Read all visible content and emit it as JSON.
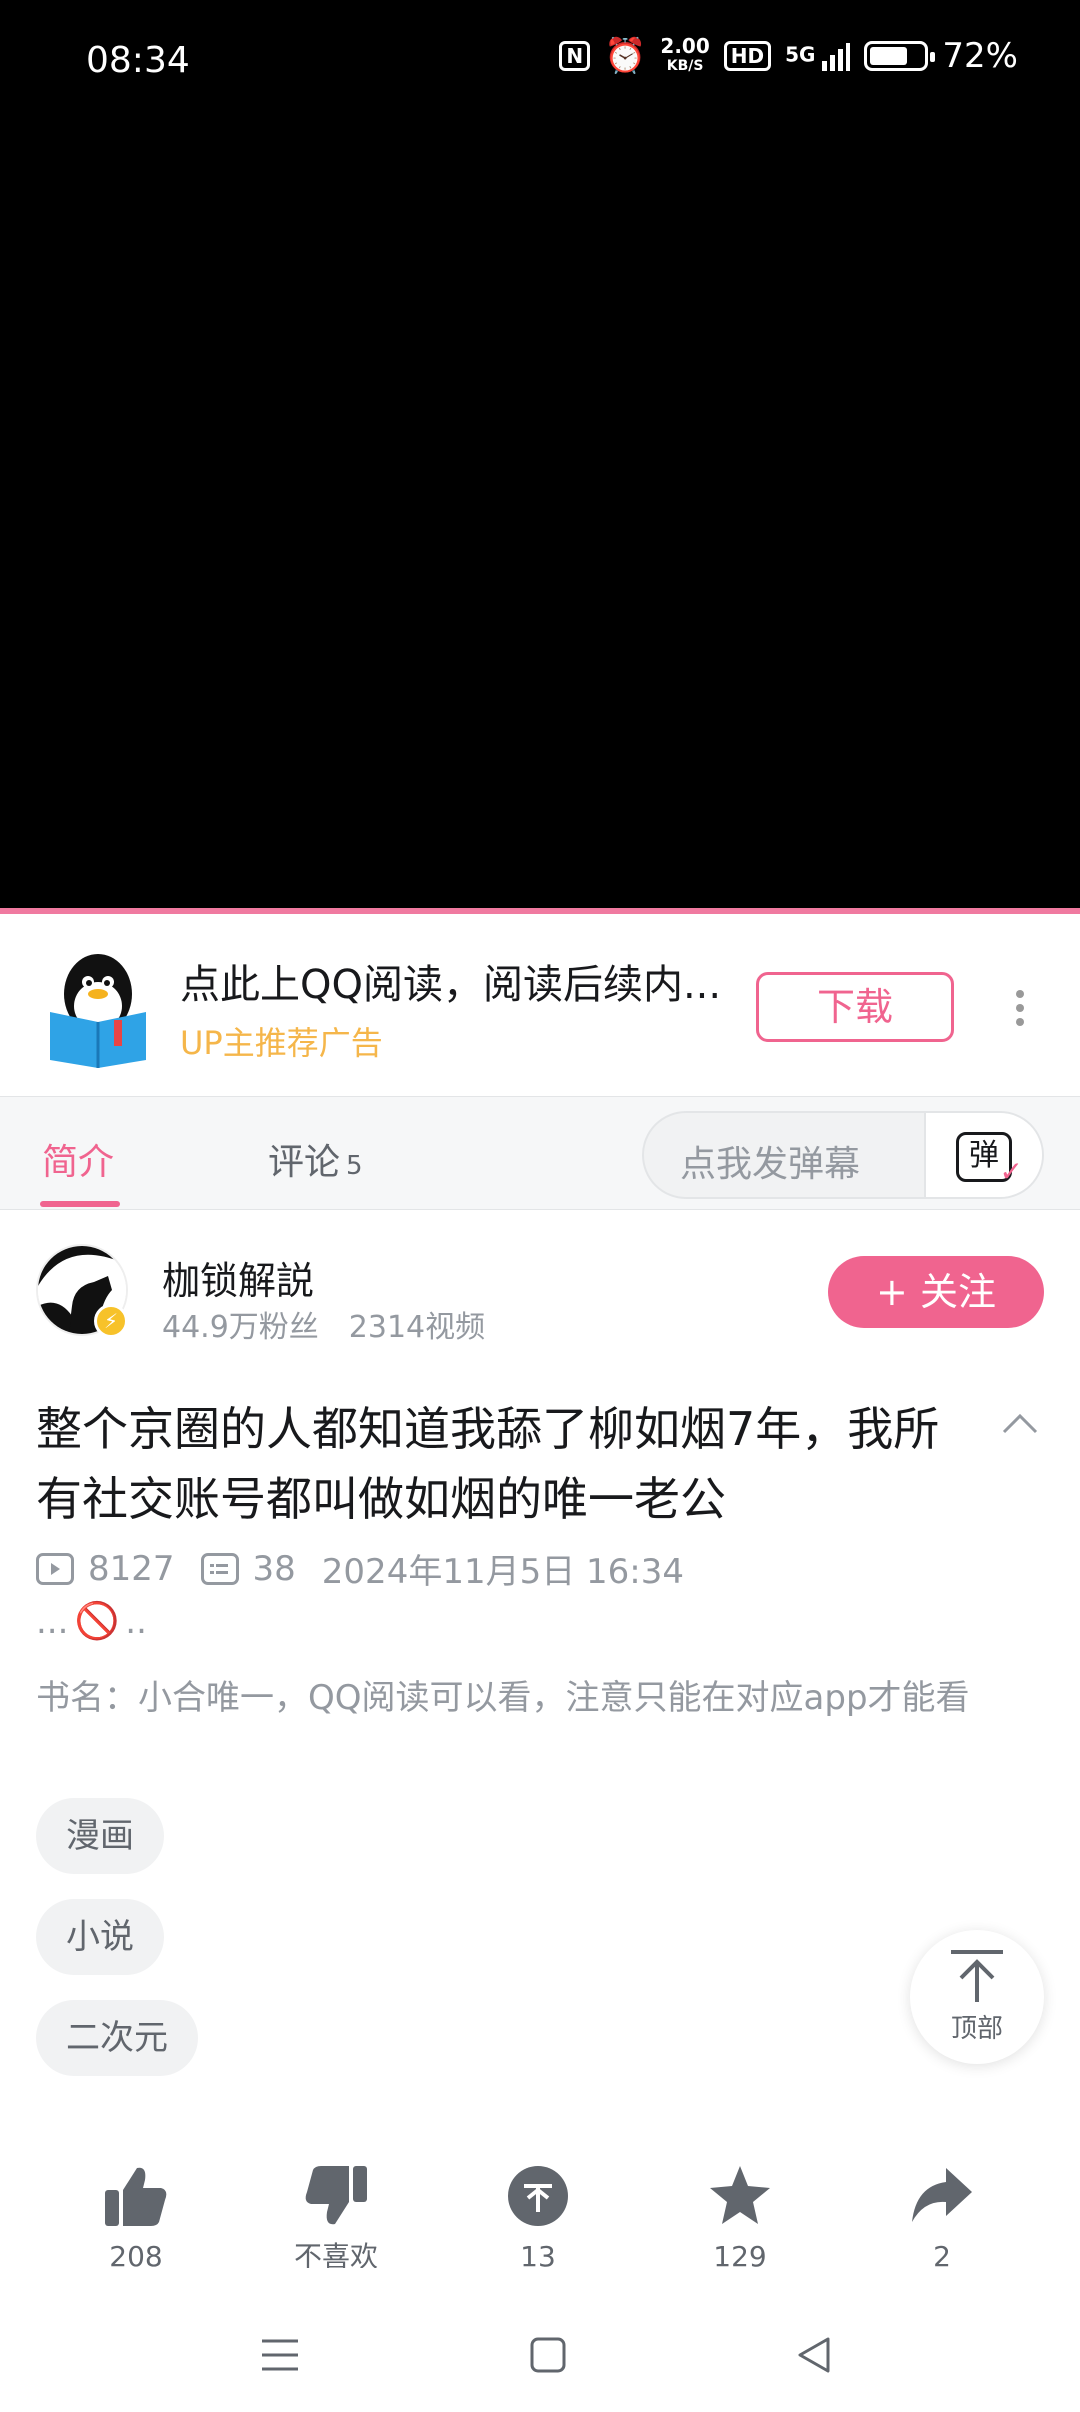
{
  "status_bar": {
    "time": "08:34",
    "speed_top": "2.00",
    "speed_unit": "KB/S",
    "hd_label": "HD",
    "network": "5G",
    "battery_percent": "72%",
    "battery_level": 0.72
  },
  "ad": {
    "title": "点此上QQ阅读，阅读后续内...",
    "subtitle": "UP主推荐广告",
    "download_label": "下载"
  },
  "tabs": {
    "intro_label": "简介",
    "comments_label": "评论",
    "comments_count": "5",
    "danmaku_placeholder": "点我发弹幕",
    "danmaku_button_glyph": "弹"
  },
  "uploader": {
    "name": "枷锁解説",
    "fans": "44.9万粉丝",
    "videos": "2314视频",
    "follow_label": "+ 关注"
  },
  "video": {
    "title": "整个京圈的人都知道我舔了柳如烟7年，我所有社交账号都叫做如烟的唯一老公",
    "plays": "8127",
    "danmaku_count": "38",
    "published": "2024年11月5日 16:34",
    "extra_prefix": "...",
    "extra_suffix": "..",
    "description": "书名：小合唯一，QQ阅读可以看，注意只能在对应app才能看"
  },
  "tags": [
    "漫画",
    "小说",
    "二次元"
  ],
  "back_to_top_label": "顶部",
  "actions": {
    "like_count": "208",
    "dislike_label": "不喜欢",
    "coin_count": "13",
    "favorite_count": "129",
    "share_count": "2"
  },
  "colors": {
    "accent": "#f0648f",
    "ad_subtitle": "#f5b64a"
  }
}
